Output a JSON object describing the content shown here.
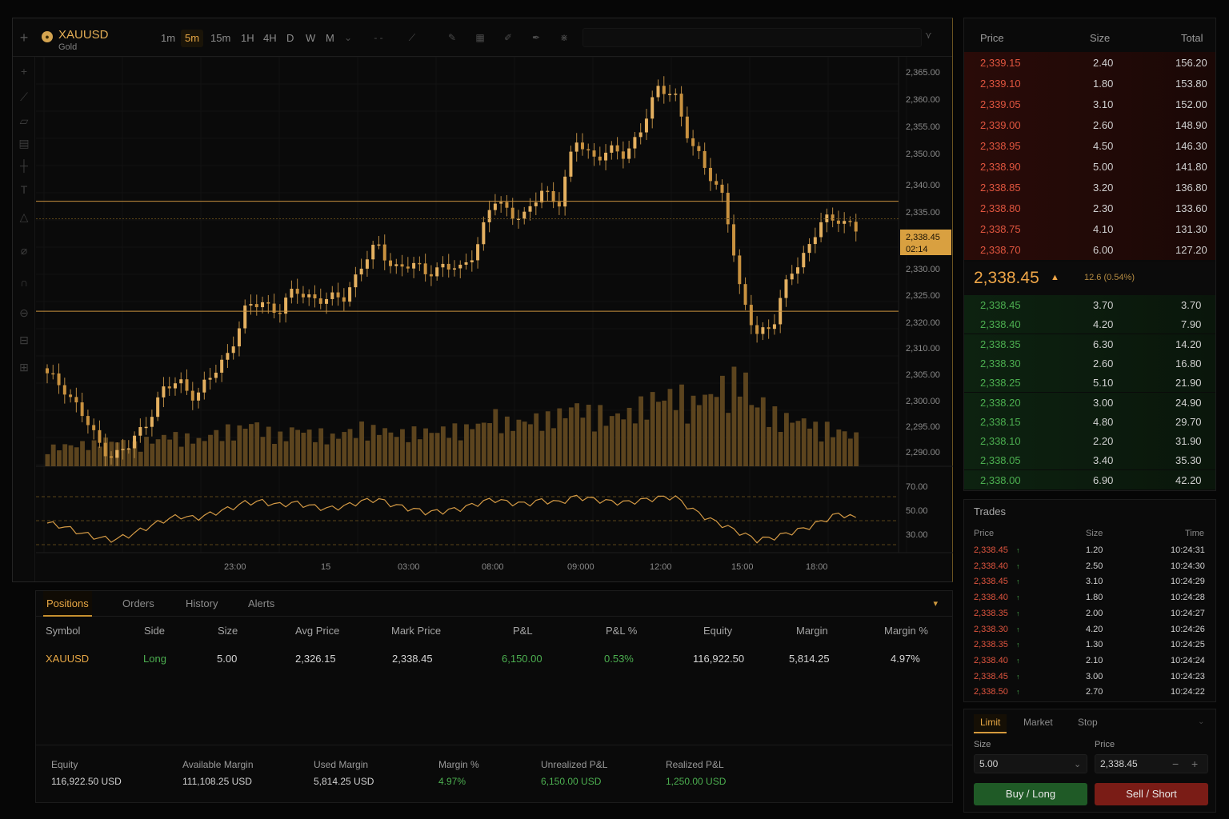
{
  "symbol": {
    "name": "XAUUSD",
    "subtitle": "Gold"
  },
  "timeframes": [
    "1m",
    "5m",
    "15m",
    "1H",
    "4H",
    "D",
    "W",
    "M"
  ],
  "active_timeframe": "5m",
  "chart_data": {
    "type": "candlestick",
    "price_axis": [
      "2,365.00",
      "2,360.00",
      "2,355.00",
      "2,350.00",
      "2,340.00",
      "2,335.00",
      "2,330.00",
      "2,325.00",
      "2,320.00",
      "2,310.00",
      "2,305.00",
      "2,300.00",
      "2,295.00",
      "2,290.00"
    ],
    "current_price_label": "2,338.45",
    "countdown": "02:14",
    "horizontal_levels": [
      2340.0,
      2318.0
    ],
    "time_axis": [
      "23:00",
      "15",
      "03:00",
      "08:00",
      "09:000",
      "12:00",
      "15:00",
      "18:00"
    ],
    "close": [
      2305,
      2303,
      2298,
      2292,
      2289,
      2291,
      2296,
      2302,
      2304,
      2301,
      2305,
      2310,
      2318,
      2320,
      2318,
      2322,
      2321,
      2320,
      2321,
      2327,
      2331,
      2327,
      2327,
      2326,
      2327,
      2326,
      2331,
      2340,
      2338,
      2337,
      2342,
      2340,
      2352,
      2349,
      2350,
      2349,
      2355,
      2362,
      2362,
      2351,
      2346,
      2341,
      2321,
      2314,
      2315,
      2326,
      2330,
      2336,
      2337,
      2334
    ],
    "volume": [
      0.22,
      0.24,
      0.26,
      0.3,
      0.28,
      0.25,
      0.3,
      0.35,
      0.33,
      0.3,
      0.38,
      0.42,
      0.48,
      0.4,
      0.35,
      0.42,
      0.38,
      0.34,
      0.4,
      0.45,
      0.42,
      0.38,
      0.4,
      0.4,
      0.42,
      0.43,
      0.48,
      0.58,
      0.5,
      0.52,
      0.55,
      0.6,
      0.68,
      0.62,
      0.55,
      0.6,
      0.7,
      0.78,
      0.82,
      0.72,
      0.8,
      0.92,
      1.0,
      0.72,
      0.6,
      0.55,
      0.52,
      0.45,
      0.4,
      0.35
    ],
    "rsi_axis": [
      "70.00",
      "50.00",
      "30.00"
    ],
    "rsi": [
      48,
      45,
      40,
      36,
      34,
      38,
      44,
      50,
      54,
      52,
      56,
      60,
      65,
      66,
      63,
      65,
      62,
      60,
      62,
      66,
      68,
      63,
      60,
      57,
      58,
      60,
      64,
      68,
      65,
      64,
      67,
      65,
      70,
      68,
      66,
      65,
      67,
      69,
      70,
      60,
      52,
      46,
      40,
      34,
      36,
      40,
      44,
      50,
      56,
      52
    ]
  },
  "orderbook": {
    "headers": {
      "price": "Price",
      "size": "Size",
      "total": "Total"
    },
    "asks": [
      {
        "price": "2,339.15",
        "size": "2.40",
        "total": "156.20"
      },
      {
        "price": "2,339.10",
        "size": "1.80",
        "total": "153.80"
      },
      {
        "price": "2,339.05",
        "size": "3.10",
        "total": "152.00"
      },
      {
        "price": "2,339.00",
        "size": "2.60",
        "total": "148.90"
      },
      {
        "price": "2,338.95",
        "size": "4.50",
        "total": "146.30"
      },
      {
        "price": "2,338.90",
        "size": "5.00",
        "total": "141.80"
      },
      {
        "price": "2,338.85",
        "size": "3.20",
        "total": "136.80"
      },
      {
        "price": "2,338.80",
        "size": "2.30",
        "total": "133.60"
      },
      {
        "price": "2,338.75",
        "size": "4.10",
        "total": "131.30"
      },
      {
        "price": "2,338.70",
        "size": "6.00",
        "total": "127.20"
      }
    ],
    "mid_price": "2,338.45",
    "mid_change": "12.6 (0.54%)",
    "bids": [
      {
        "price": "2,338.45",
        "size": "3.70",
        "total": "3.70"
      },
      {
        "price": "2,338.40",
        "size": "4.20",
        "total": "7.90"
      },
      {
        "price": "2,338.35",
        "size": "6.30",
        "total": "14.20"
      },
      {
        "price": "2,338.30",
        "size": "2.60",
        "total": "16.80"
      },
      {
        "price": "2,338.25",
        "size": "5.10",
        "total": "21.90"
      },
      {
        "price": "2,338.20",
        "size": "3.00",
        "total": "24.90"
      },
      {
        "price": "2,338.15",
        "size": "4.80",
        "total": "29.70"
      },
      {
        "price": "2,338.10",
        "size": "2.20",
        "total": "31.90"
      },
      {
        "price": "2,338.05",
        "size": "3.40",
        "total": "35.30"
      },
      {
        "price": "2,338.00",
        "size": "6.90",
        "total": "42.20"
      }
    ]
  },
  "trades": {
    "title": "Trades",
    "headers": {
      "price": "Price",
      "size": "Size",
      "time": "Time"
    },
    "rows": [
      {
        "price": "2,338.45",
        "size": "1.20",
        "time": "10:24:31"
      },
      {
        "price": "2,338.40",
        "size": "2.50",
        "time": "10:24:30"
      },
      {
        "price": "2,338.45",
        "size": "3.10",
        "time": "10:24:29"
      },
      {
        "price": "2,338.40",
        "size": "1.80",
        "time": "10:24:28"
      },
      {
        "price": "2,338.35",
        "size": "2.00",
        "time": "10:24:27"
      },
      {
        "price": "2,338.30",
        "size": "4.20",
        "time": "10:24:26"
      },
      {
        "price": "2,338.35",
        "size": "1.30",
        "time": "10:24:25"
      },
      {
        "price": "2,338.40",
        "size": "2.10",
        "time": "10:24:24"
      },
      {
        "price": "2,338.45",
        "size": "3.00",
        "time": "10:24:23"
      },
      {
        "price": "2,338.50",
        "size": "2.70",
        "time": "10:24:22"
      }
    ]
  },
  "order_form": {
    "tabs": [
      "Limit",
      "Market",
      "Stop"
    ],
    "size_label": "Size",
    "size_value": "5.00",
    "price_label": "Price",
    "price_value": "2,338.45",
    "buy_label": "Buy / Long",
    "sell_label": "Sell / Short"
  },
  "positions": {
    "tabs": [
      "Positions",
      "Orders",
      "History",
      "Alerts"
    ],
    "columns": [
      "Symbol",
      "Side",
      "Size",
      "Avg Price",
      "Mark Price",
      "P&L",
      "P&L %",
      "Equity",
      "Margin",
      "Margin %"
    ],
    "row": [
      "XAUUSD",
      "Long",
      "5.00",
      "2,326.15",
      "2,338.45",
      "6,150.00",
      "0.53%",
      "116,922.50",
      "5,814.25",
      "4.97%"
    ]
  },
  "account": [
    {
      "label": "Equity",
      "value": "116,922.50 USD"
    },
    {
      "label": "Available Margin",
      "value": "111,108.25 USD"
    },
    {
      "label": "Used Margin",
      "value": "5,814.25 USD"
    },
    {
      "label": "Margin %",
      "value": "4.97%"
    },
    {
      "label": "Unrealized P&L",
      "value": "6,150.00 USD"
    },
    {
      "label": "Realized P&L",
      "value": "1,250.00 USD"
    }
  ],
  "colors": {
    "accent": "#e8a845",
    "up": "#4caf50",
    "down": "#e0553f",
    "candle": "#d9a450"
  }
}
